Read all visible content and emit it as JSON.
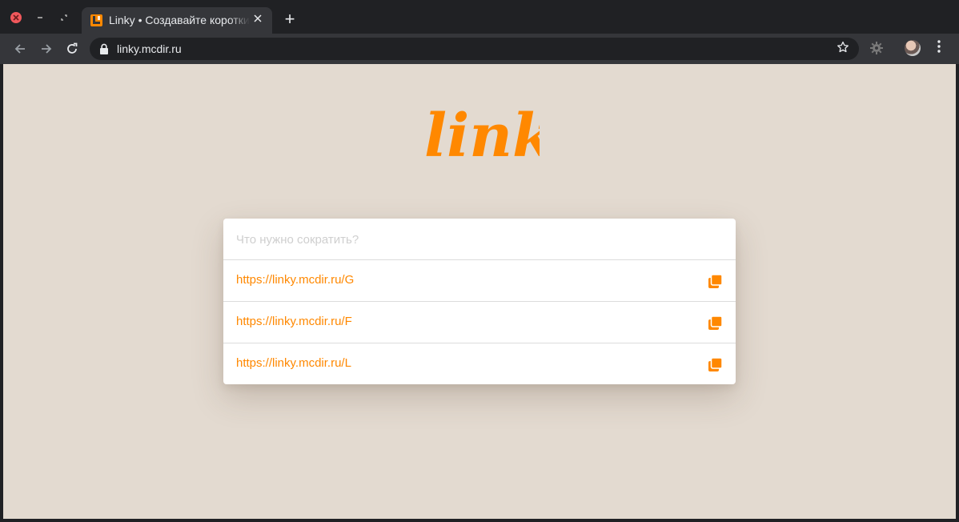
{
  "browser": {
    "tab_title": "Linky • Создавайте короткие ссылки",
    "new_tab_label": "+",
    "url": "linky.mcdir.ru"
  },
  "page": {
    "logo_text": "linky",
    "accent_color": "#ff8800",
    "background_color": "#e3dad0",
    "search": {
      "placeholder": "Что нужно сократить?",
      "value": ""
    },
    "links": [
      {
        "url": "https://linky.mcdir.ru/G",
        "action_icon": "copy-icon"
      },
      {
        "url": "https://linky.mcdir.ru/F",
        "action_icon": "copy-icon"
      },
      {
        "url": "https://linky.mcdir.ru/L",
        "action_icon": "copy-icon"
      }
    ]
  }
}
